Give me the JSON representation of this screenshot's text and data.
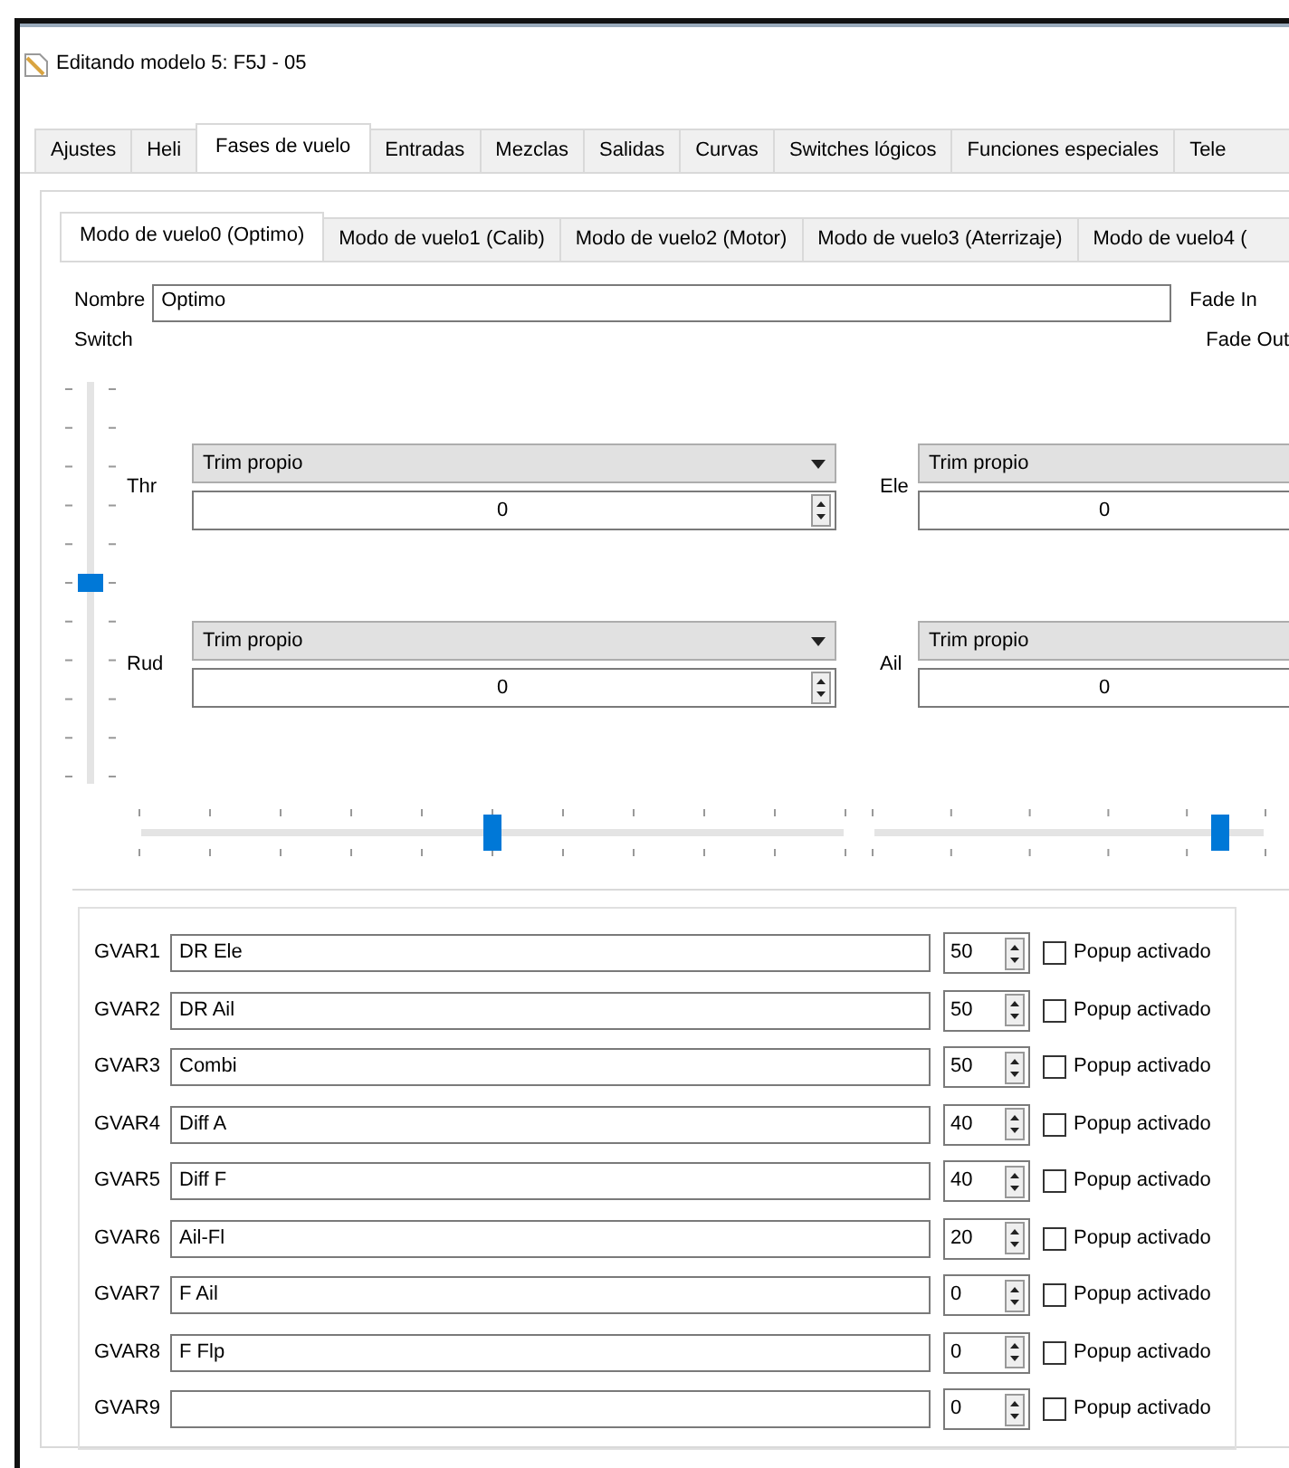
{
  "window": {
    "title": "Editando modelo 5: F5J - 05"
  },
  "tabs": [
    {
      "label": "Ajustes",
      "selected": false
    },
    {
      "label": "Heli",
      "selected": false
    },
    {
      "label": "Fases de vuelo",
      "selected": true
    },
    {
      "label": "Entradas",
      "selected": false
    },
    {
      "label": "Mezclas",
      "selected": false
    },
    {
      "label": "Salidas",
      "selected": false
    },
    {
      "label": "Curvas",
      "selected": false
    },
    {
      "label": "Switches lógicos",
      "selected": false
    },
    {
      "label": "Funciones especiales",
      "selected": false
    },
    {
      "label": "Tele",
      "selected": false
    }
  ],
  "phase_tabs": [
    {
      "label": "Modo de vuelo0 (Optimo)",
      "selected": true
    },
    {
      "label": "Modo de vuelo1 (Calib)",
      "selected": false
    },
    {
      "label": "Modo de vuelo2 (Motor)",
      "selected": false
    },
    {
      "label": "Modo de vuelo3 (Aterrizaje)",
      "selected": false
    },
    {
      "label": "Modo de vuelo4 (",
      "selected": false
    }
  ],
  "name_field": {
    "label": "Nombre",
    "value": "Optimo"
  },
  "fade_in_label": "Fade In",
  "switch_label": "Switch",
  "fade_out_label": "Fade Out",
  "switch_slider": {
    "level": 0.5
  },
  "trims": [
    {
      "label": "Thr",
      "mode": "Trim propio",
      "value": "0"
    },
    {
      "label": "Ele",
      "mode": "Trim propio",
      "value": "0"
    },
    {
      "label": "Rud",
      "mode": "Trim propio",
      "value": "0"
    },
    {
      "label": "Ail",
      "mode": "Trim propio",
      "value": "0"
    }
  ],
  "trim_sliders": [
    {
      "level": 0.5
    },
    {
      "level": 0.89
    }
  ],
  "gvars": [
    {
      "label": "GVAR1",
      "name": "DR Ele",
      "value": "50",
      "popup_label": "Popup activado",
      "checked": false
    },
    {
      "label": "GVAR2",
      "name": "DR Ail",
      "value": "50",
      "popup_label": "Popup activado",
      "checked": false
    },
    {
      "label": "GVAR3",
      "name": "Combi",
      "value": "50",
      "popup_label": "Popup activado",
      "checked": false
    },
    {
      "label": "GVAR4",
      "name": "Diff A",
      "value": "40",
      "popup_label": "Popup activado",
      "checked": false
    },
    {
      "label": "GVAR5",
      "name": "Diff F",
      "value": "40",
      "popup_label": "Popup activado",
      "checked": false
    },
    {
      "label": "GVAR6",
      "name": "Ail-Fl",
      "value": "20",
      "popup_label": "Popup activado",
      "checked": false
    },
    {
      "label": "GVAR7",
      "name": "F Ail",
      "value": "0",
      "popup_label": "Popup activado",
      "checked": false
    },
    {
      "label": "GVAR8",
      "name": "F Flp",
      "value": "0",
      "popup_label": "Popup activado",
      "checked": false
    },
    {
      "label": "GVAR9",
      "value": "0",
      "popup_label": "Popup activado",
      "checked": false
    }
  ]
}
